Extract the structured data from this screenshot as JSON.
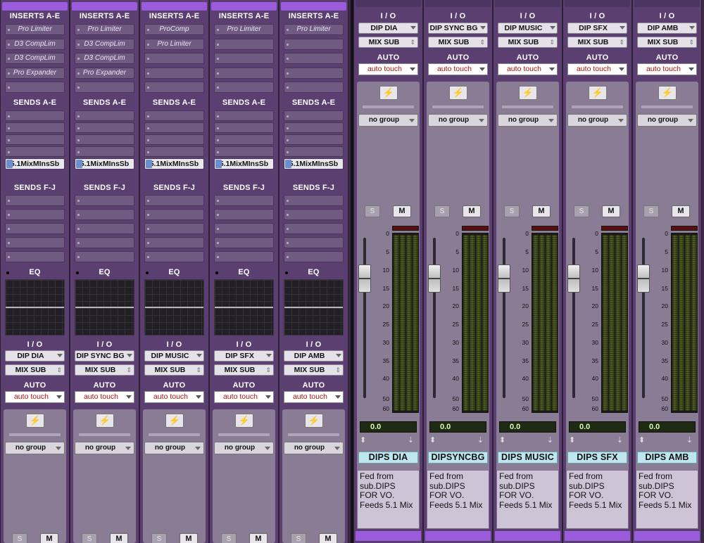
{
  "left_pane": {
    "headers": {
      "inserts": "INSERTS A-E",
      "sends_ae": "SENDS A-E",
      "sends_fj": "SENDS F-J",
      "eq": "EQ",
      "io": "I / O",
      "auto": "AUTO"
    },
    "strips": [
      {
        "inserts": [
          "Pro Limiter",
          "D3 CompLim",
          "D3 CompLim",
          "Pro Expander",
          ""
        ],
        "send_a": "5.1MixMInsSb",
        "output": "DIP DIA",
        "bus": "MIX SUB",
        "automation": "auto touch",
        "group": "no group",
        "solo": "S",
        "mute": "M",
        "bolt": "⚡"
      },
      {
        "inserts": [
          "Pro Limiter",
          "D3 CompLim",
          "D3 CompLim",
          "Pro Expander",
          ""
        ],
        "send_a": "5.1MixMInsSb",
        "output": "DIP SYNC BG",
        "bus": "MIX SUB",
        "automation": "auto touch",
        "group": "no group",
        "solo": "S",
        "mute": "M",
        "bolt": "⚡"
      },
      {
        "inserts": [
          "ProComp",
          "Pro Limiter",
          "",
          "",
          ""
        ],
        "send_a": "5.1MixMInsSb",
        "output": "DIP MUSIC",
        "bus": "MIX SUB",
        "automation": "auto touch",
        "group": "no group",
        "solo": "S",
        "mute": "M",
        "bolt": "⚡"
      },
      {
        "inserts": [
          "Pro Limiter",
          "",
          "",
          "",
          ""
        ],
        "send_a": "5.1MixMInsSb",
        "output": "DIP SFX",
        "bus": "MIX SUB",
        "automation": "auto touch",
        "group": "no group",
        "solo": "S",
        "mute": "M",
        "bolt": "⚡"
      },
      {
        "inserts": [
          "Pro Limiter",
          "",
          "",
          "",
          ""
        ],
        "send_a": "5.1MixMInsSb",
        "output": "DIP AMB",
        "bus": "MIX SUB",
        "automation": "auto touch",
        "group": "no group",
        "solo": "S",
        "mute": "M",
        "bolt": "⚡"
      }
    ]
  },
  "right_pane": {
    "headers": {
      "io": "I / O",
      "auto": "AUTO"
    },
    "meter_scale": [
      "0",
      "5",
      "10",
      "15",
      "20",
      "25",
      "30",
      "35",
      "40",
      "50",
      "60"
    ],
    "strips": [
      {
        "output": "DIP DIA",
        "bus": "MIX SUB",
        "automation": "auto touch",
        "group": "no group",
        "solo": "S",
        "mute": "M",
        "bolt": "⚡",
        "volume": "0.0",
        "track_name": "DIPS DIA",
        "comment": "Fed from\nsub.DIPS\nFOR VO.\nFeeds 5.1 Mix"
      },
      {
        "output": "DIP SYNC BG",
        "bus": "MIX SUB",
        "automation": "auto touch",
        "group": "no group",
        "solo": "S",
        "mute": "M",
        "bolt": "⚡",
        "volume": "0.0",
        "track_name": "DIPSYNCBG",
        "comment": "Fed from\nsub.DIPS\nFOR VO.\nFeeds 5.1 Mix"
      },
      {
        "output": "DIP MUSIC",
        "bus": "MIX SUB",
        "automation": "auto touch",
        "group": "no group",
        "solo": "S",
        "mute": "M",
        "bolt": "⚡",
        "volume": "0.0",
        "track_name": "DIPS MUSIC",
        "comment": "Fed from\nsub.DIPS\nFOR VO.\nFeeds 5.1 Mix"
      },
      {
        "output": "DIP SFX",
        "bus": "MIX SUB",
        "automation": "auto touch",
        "group": "no group",
        "solo": "S",
        "mute": "M",
        "bolt": "⚡",
        "volume": "0.0",
        "track_name": "DIPS SFX",
        "comment": "Fed from\nsub.DIPS\nFOR VO.\nFeeds 5.1 Mix"
      },
      {
        "output": "DIP AMB",
        "bus": "MIX SUB",
        "automation": "auto touch",
        "group": "no group",
        "solo": "S",
        "mute": "M",
        "bolt": "⚡",
        "volume": "0.0",
        "track_name": "DIPS AMB",
        "comment": "Fed from\nsub.DIPS\nFOR VO.\nFeeds 5.1 Mix"
      }
    ]
  },
  "colors": {
    "strip_bg": "#5a3f70",
    "accent_purple": "#9a5cdc",
    "name_plate": "#bfe6ee",
    "auto_text": "#aa1111"
  }
}
